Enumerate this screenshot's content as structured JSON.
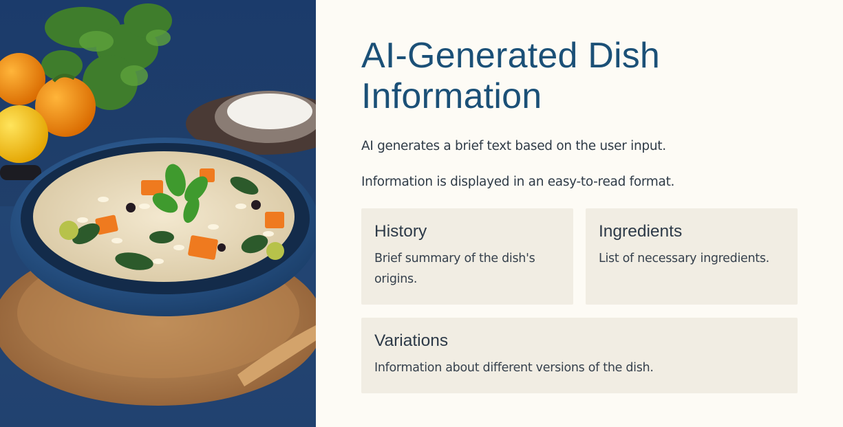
{
  "page": {
    "title": "AI-Generated Dish Information",
    "description_lines": [
      "AI generates a brief text based on the user input.",
      "Information is displayed in an easy-to-read format."
    ]
  },
  "cards": {
    "history": {
      "title": "History",
      "text": "Brief summary of the dish's origins."
    },
    "ingredients": {
      "title": "Ingredients",
      "text": "List of necessary ingredients."
    },
    "variations": {
      "title": "Variations",
      "text": "Information about different versions of the dish."
    }
  },
  "colors": {
    "background": "#fdfbf5",
    "title": "#1b5077",
    "card_background": "#f1ede3",
    "body_text": "#2f3b47",
    "photo_backdrop": "#1f3c66"
  }
}
